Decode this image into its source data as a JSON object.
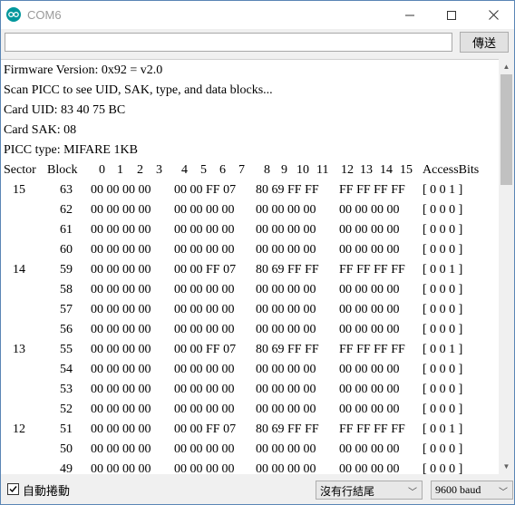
{
  "window": {
    "title": "COM6"
  },
  "send": {
    "input_value": "",
    "button_label": "傳送"
  },
  "output": {
    "header_lines": [
      "Firmware Version: 0x92 = v2.0",
      "Scan PICC to see UID, SAK, type, and data blocks...",
      "Card UID: 83 40 75 BC",
      "Card SAK: 08",
      "PICC type: MIFARE 1KB"
    ],
    "table_header": {
      "sector": "Sector",
      "block": "Block",
      "byte_indices": [
        "0",
        "1",
        "2",
        "3",
        "4",
        "5",
        "6",
        "7",
        "8",
        "9",
        "10",
        "11",
        "12",
        "13",
        "14",
        "15"
      ],
      "access_bits": "AccessBits"
    },
    "rows": [
      {
        "sector": "15",
        "block": "63",
        "bytes": [
          "00 00 00 00",
          "00 00 FF 07",
          "80 69 FF FF",
          "FF FF FF FF"
        ],
        "access": "[ 0 0 1 ]"
      },
      {
        "sector": "",
        "block": "62",
        "bytes": [
          "00 00 00 00",
          "00 00 00 00",
          "00 00 00 00",
          "00 00 00 00"
        ],
        "access": "[ 0 0 0 ]"
      },
      {
        "sector": "",
        "block": "61",
        "bytes": [
          "00 00 00 00",
          "00 00 00 00",
          "00 00 00 00",
          "00 00 00 00"
        ],
        "access": "[ 0 0 0 ]"
      },
      {
        "sector": "",
        "block": "60",
        "bytes": [
          "00 00 00 00",
          "00 00 00 00",
          "00 00 00 00",
          "00 00 00 00"
        ],
        "access": "[ 0 0 0 ]"
      },
      {
        "sector": "14",
        "block": "59",
        "bytes": [
          "00 00 00 00",
          "00 00 FF 07",
          "80 69 FF FF",
          "FF FF FF FF"
        ],
        "access": "[ 0 0 1 ]"
      },
      {
        "sector": "",
        "block": "58",
        "bytes": [
          "00 00 00 00",
          "00 00 00 00",
          "00 00 00 00",
          "00 00 00 00"
        ],
        "access": "[ 0 0 0 ]"
      },
      {
        "sector": "",
        "block": "57",
        "bytes": [
          "00 00 00 00",
          "00 00 00 00",
          "00 00 00 00",
          "00 00 00 00"
        ],
        "access": "[ 0 0 0 ]"
      },
      {
        "sector": "",
        "block": "56",
        "bytes": [
          "00 00 00 00",
          "00 00 00 00",
          "00 00 00 00",
          "00 00 00 00"
        ],
        "access": "[ 0 0 0 ]"
      },
      {
        "sector": "13",
        "block": "55",
        "bytes": [
          "00 00 00 00",
          "00 00 FF 07",
          "80 69 FF FF",
          "FF FF FF FF"
        ],
        "access": "[ 0 0 1 ]"
      },
      {
        "sector": "",
        "block": "54",
        "bytes": [
          "00 00 00 00",
          "00 00 00 00",
          "00 00 00 00",
          "00 00 00 00"
        ],
        "access": "[ 0 0 0 ]"
      },
      {
        "sector": "",
        "block": "53",
        "bytes": [
          "00 00 00 00",
          "00 00 00 00",
          "00 00 00 00",
          "00 00 00 00"
        ],
        "access": "[ 0 0 0 ]"
      },
      {
        "sector": "",
        "block": "52",
        "bytes": [
          "00 00 00 00",
          "00 00 00 00",
          "00 00 00 00",
          "00 00 00 00"
        ],
        "access": "[ 0 0 0 ]"
      },
      {
        "sector": "12",
        "block": "51",
        "bytes": [
          "00 00 00 00",
          "00 00 FF 07",
          "80 69 FF FF",
          "FF FF FF FF"
        ],
        "access": "[ 0 0 1 ]"
      },
      {
        "sector": "",
        "block": "50",
        "bytes": [
          "00 00 00 00",
          "00 00 00 00",
          "00 00 00 00",
          "00 00 00 00"
        ],
        "access": "[ 0 0 0 ]"
      },
      {
        "sector": "",
        "block": "49",
        "bytes": [
          "00 00 00 00",
          "00 00 00 00",
          "00 00 00 00",
          "00 00 00 00"
        ],
        "access": "[ 0 0 0 ]"
      }
    ]
  },
  "bottom": {
    "autoscroll_label": "自動捲動",
    "autoscroll_checked": true,
    "line_ending": "沒有行結尾",
    "baud": "9600 baud"
  },
  "icons": {
    "app": "arduino-icon",
    "minimize": "minimize-icon",
    "maximize": "maximize-icon",
    "close": "close-icon",
    "scroll_up": "scroll-up-icon",
    "scroll_down": "scroll-down-icon",
    "dropdown": "chevron-down-icon",
    "check": "check-icon"
  },
  "colors": {
    "accent": "#00979c",
    "window_border": "#5a86b5"
  }
}
